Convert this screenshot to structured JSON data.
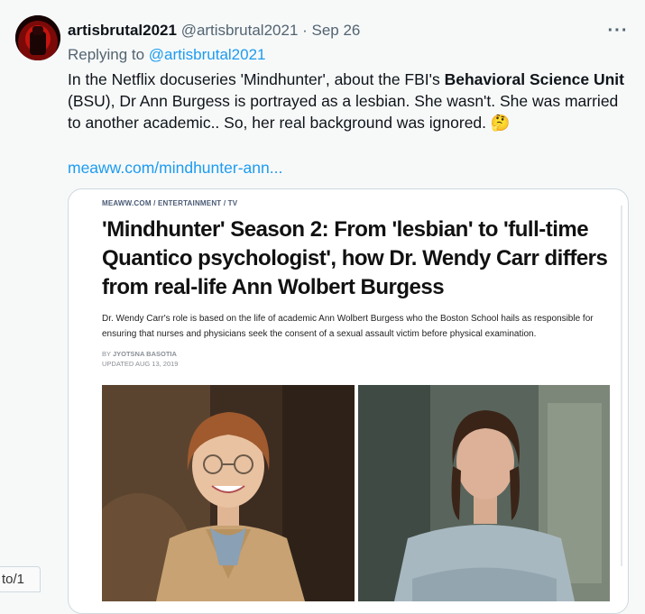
{
  "tweet": {
    "display_name": "artisbrutal2021",
    "meta": "@artisbrutal2021 · Sep 26",
    "more_label": "···",
    "reply_prefix": "Replying to ",
    "reply_handle": "@artisbrutal2021",
    "text_part1": "In the Netflix docuseries 'Mindhunter', about the FBI's ",
    "text_bold": "Behavioral Science Unit",
    "text_part2": " (BSU), Dr Ann Burgess is portrayed as a lesbian.  She wasn't.  She was married to another academic.. So, her real background was ignored. ",
    "emoji": "🤔",
    "link_text": "meaww.com/mindhunter-ann..."
  },
  "card": {
    "crumb": "MEAWW.COM / ENTERTAINMENT / TV",
    "headline": "'Mindhunter' Season 2: From 'lesbian' to 'full-time Quantico psychologist', how Dr. Wendy Carr differs from real-life Ann Wolbert Burgess",
    "dek": "Dr. Wendy Carr's role is based on the life of academic Ann Wolbert Burgess who the Boston School hails as responsible for ensuring that nurses and physicians seek the consent of a sexual assault victim before physical examination.",
    "byline_prefix": "BY ",
    "author": "JYOTSNA BASOTIA",
    "updated": "UPDATED AUG 13, 2019"
  },
  "side": {
    "label": "to/1"
  },
  "icons": [
    "avatar-image",
    "more-options-icon"
  ]
}
